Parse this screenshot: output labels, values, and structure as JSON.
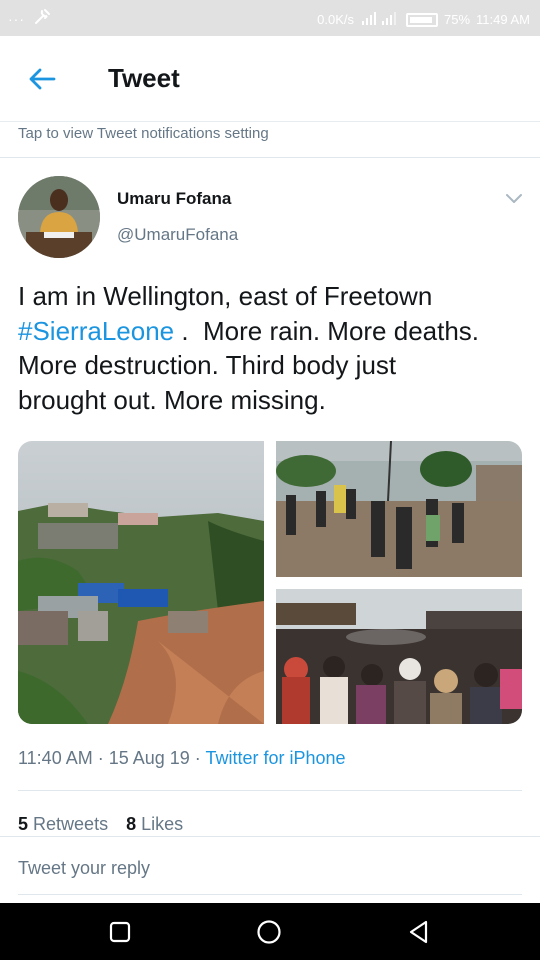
{
  "status_bar": {
    "left_glyphs": "···",
    "speed": "0.0K/s",
    "battery": "75%",
    "time": "11:49 AM"
  },
  "header": {
    "title": "Tweet"
  },
  "notification": {
    "text": "Tap to view Tweet notifications setting"
  },
  "tweet": {
    "author_name": "Umaru Fofana",
    "author_handle": "@UmaruFofana",
    "text_line1": "I am in Wellington, east of Freetown",
    "hashtag": "#SierraLeone",
    "text_line2_rest": " .  More rain. More deaths.",
    "text_line3": "More destruction. Third body just",
    "text_line4": "brought out. More missing.",
    "timestamp": "11:40 AM · 15 Aug 19 · ",
    "source": "Twitter for iPhone",
    "retweets_count": "5",
    "retweets_label": "Retweets",
    "likes_count": "8",
    "likes_label": "Likes"
  },
  "reply": {
    "placeholder": "Tweet your reply"
  },
  "colors": {
    "accent": "#1b95e0",
    "secondary_text": "#657786",
    "status_bar_bg": "#e1e1e1"
  }
}
